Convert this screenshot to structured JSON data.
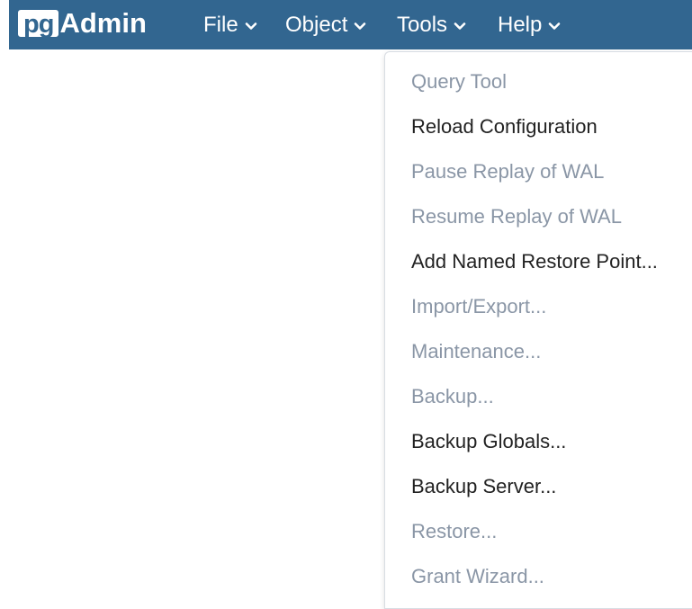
{
  "app": {
    "logo_pg": "pg",
    "logo_admin": "Admin",
    "brand_color": "#326690"
  },
  "menubar": {
    "file": "File",
    "object": "Object",
    "tools": "Tools",
    "help": "Help"
  },
  "tools_menu": {
    "items": [
      {
        "label": "Query Tool",
        "enabled": false
      },
      {
        "label": "Reload Configuration",
        "enabled": true
      },
      {
        "label": "Pause Replay of WAL",
        "enabled": false
      },
      {
        "label": "Resume Replay of WAL",
        "enabled": false
      },
      {
        "label": "Add Named Restore Point...",
        "enabled": true
      },
      {
        "label": "Import/Export...",
        "enabled": false
      },
      {
        "label": "Maintenance...",
        "enabled": false
      },
      {
        "label": "Backup...",
        "enabled": false
      },
      {
        "label": "Backup Globals...",
        "enabled": true
      },
      {
        "label": "Backup Server...",
        "enabled": true
      },
      {
        "label": "Restore...",
        "enabled": false
      },
      {
        "label": "Grant Wizard...",
        "enabled": false
      }
    ],
    "enabled_color": "#222222",
    "disabled_color": "#8a96a6"
  }
}
